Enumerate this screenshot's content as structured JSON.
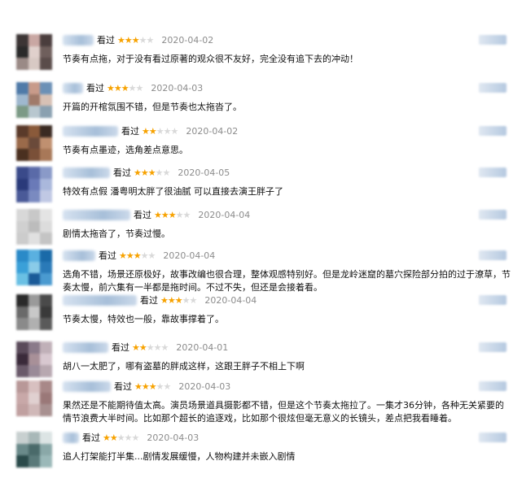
{
  "reviews": [
    {
      "seen": "看过",
      "rating": 3,
      "date": "2020-04-02",
      "text": "节奏有点拖，对于没有看过原著的观众很不友好，完全没有追下去的冲动！"
    },
    {
      "seen": "看过",
      "rating": 3,
      "date": "2020-04-03",
      "text": "开篇的开棺氛围不错，但是节奏也太拖沓了。"
    },
    {
      "seen": "看过",
      "rating": 2,
      "date": "2020-04-02",
      "text": "节奏有点墨迹，选角差点意思。"
    },
    {
      "seen": "看过",
      "rating": 3,
      "date": "2020-04-05",
      "text": "特效有点假 潘粤明太胖了很油腻 可以直接去演王胖子了"
    },
    {
      "seen": "看过",
      "rating": 3,
      "date": "2020-04-04",
      "text": "剧情太拖沓了，节奏过慢。"
    },
    {
      "seen": "看过",
      "rating": 3,
      "date": "2020-04-04",
      "text": "选角不错，场景还原极好，故事改编也很合理，整体观感特别好。但是龙岭迷窟的墓穴探险部分拍的过于潦草，节奏太慢，前六集有一半都是拖时间。不过不失，但还是会接着看。"
    },
    {
      "seen": "看过",
      "rating": 3,
      "date": "2020-04-04",
      "text": "节奏太慢，特效也一般，靠故事撑着了。"
    },
    {
      "seen": "看过",
      "rating": 2,
      "date": "2020-04-01",
      "text": "胡八一太肥了，哪有盗墓的胖成这样，这跟王胖子不相上下啊"
    },
    {
      "seen": "看过",
      "rating": 3,
      "date": "2020-04-03",
      "text": "果然还是不能期待值太高。演员场景道具摄影都不错，但是这个节奏太拖拉了。一集才36分钟，各种无关紧要的情节浪费大半时间。比如那个超长的追逐戏，比如那个很炫但毫无意义的长镜头，差点把我看睡着。"
    },
    {
      "seen": "看过",
      "rating": 2,
      "date": "2020-04-03",
      "text": "追人打架能打半集...剧情发展缓慢，人物构建并未嵌入剧情"
    }
  ]
}
